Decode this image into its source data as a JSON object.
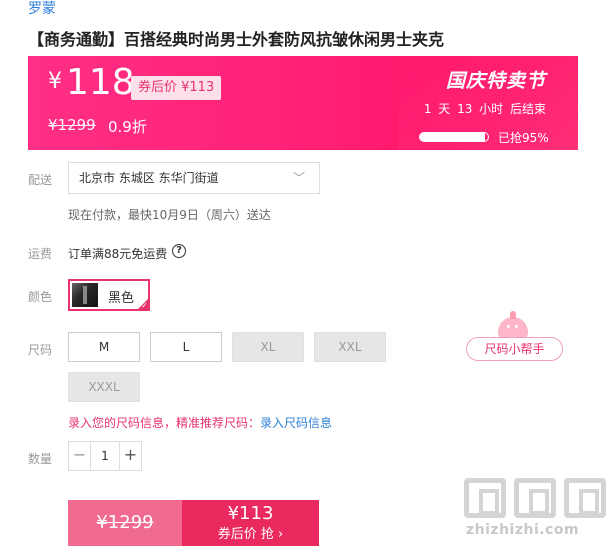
{
  "brand": "罗蒙",
  "title": "【商务通勤】百搭经典时尚男士外套防风抗皱休闲男士夹克",
  "banner": {
    "currency": "¥",
    "price": "118",
    "coupon_price_label": "券后价 ¥113",
    "original_price": "¥1299",
    "discount": "0.9折",
    "festival": "国庆特卖节",
    "countdown": "1 天 13 小时 后结束",
    "sold_percent": 95,
    "sold_text": "已抢95%",
    "colors": {
      "start": "#ff2f86",
      "end": "#ff0a60"
    }
  },
  "labels": {
    "delivery": "配送",
    "shipping": "运费",
    "color": "颜色",
    "size": "尺码",
    "quantity": "数量"
  },
  "delivery": {
    "address": "北京市 东城区 东华门街道",
    "note": "现在付款，最快10月9日（周六）送达"
  },
  "shipping": {
    "text": "订单满88元免运费"
  },
  "color": {
    "selected": "黑色"
  },
  "sizes": [
    {
      "label": "M",
      "available": true
    },
    {
      "label": "L",
      "available": true
    },
    {
      "label": "XL",
      "available": false
    },
    {
      "label": "XXL",
      "available": false
    },
    {
      "label": "XXXL",
      "available": false
    }
  ],
  "size_helper": "尺码小帮手",
  "size_note": {
    "text": "录入您的尺码信息，精准推荐尺码：",
    "link": "录入尺码信息"
  },
  "quantity": {
    "value": "1",
    "minus": "−",
    "plus": "+"
  },
  "buy": {
    "original": "¥1299",
    "coupon_price": "¥113",
    "coupon_action": "券后价 抢 ›"
  },
  "watermark": {
    "text": "zhizhizhi.com"
  },
  "accent_color": "#e8336b"
}
